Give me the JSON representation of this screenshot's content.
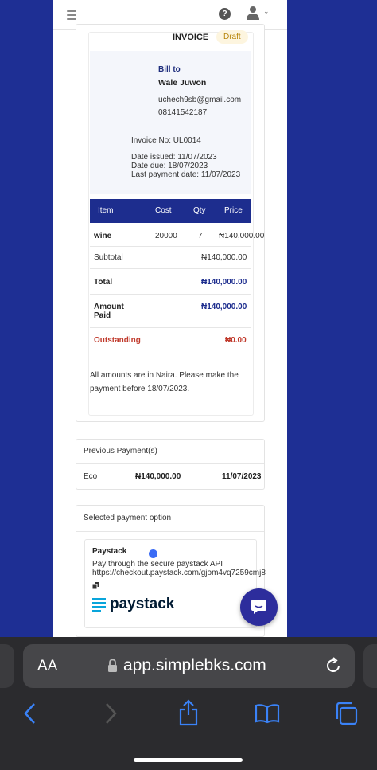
{
  "header": {
    "help_glyph": "?",
    "chevron_glyph": "⌄"
  },
  "invoice": {
    "title": "INVOICE",
    "status": "Draft",
    "bill_to_label": "Bill to",
    "customer_name": "Wale Juwon",
    "email": "uchech9sb@gmail.com",
    "phone": "08141542187",
    "invoice_no": "Invoice No: UL0014",
    "date_issued": "Date issued: 11/07/2023",
    "date_due": "Date due: 18/07/2023",
    "last_payment_date": "Last payment date: 11/07/2023",
    "columns": [
      "Item",
      "Cost",
      "Qty",
      "Price"
    ],
    "items": [
      {
        "item": "wine",
        "cost": "20000",
        "qty": "7",
        "price": "₦140,000.00"
      }
    ],
    "subtotal_label": "Subtotal",
    "subtotal_value": "₦140,000.00",
    "total_label": "Total",
    "total_value": "₦140,000.00",
    "amount_paid_label_1": "Amount",
    "amount_paid_label_2": "Paid",
    "amount_paid_value": "₦140,000.00",
    "outstanding_label": "Outstanding",
    "outstanding_value": "₦0.00",
    "note_line1": "All amounts are in Naira. Please make the",
    "note_line2": "payment before 18/07/2023."
  },
  "previous_payments": {
    "title": "Previous Payment(s)",
    "rows": [
      {
        "method": "Eco",
        "amount": "₦140,000.00",
        "date": "11/07/2023"
      }
    ]
  },
  "payment_option": {
    "title": "Selected payment option",
    "name": "Paystack",
    "description": "Pay through the secure paystack API",
    "link": "https://checkout.paystack.com/gjom4vq7259cmj8",
    "logo_text": "paystack"
  },
  "browser": {
    "text_size_label": "AA",
    "url": "app.simplebks.com"
  },
  "colors": {
    "brand_blue": "#1d2d8e",
    "background": "#1e2f94",
    "draft_bg": "#fdf5df",
    "outstanding_red": "#c0392b",
    "radio_blue": "#3b6cf5"
  }
}
